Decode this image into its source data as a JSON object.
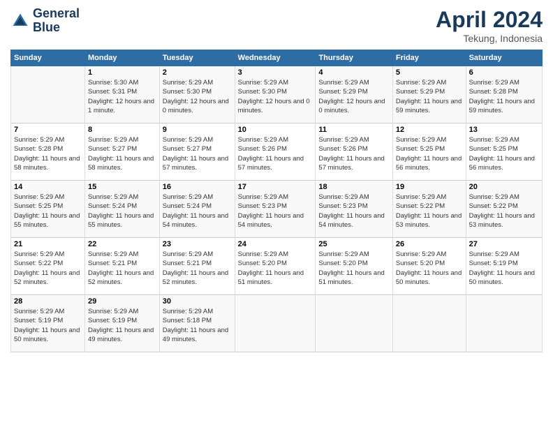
{
  "header": {
    "logo_line1": "General",
    "logo_line2": "Blue",
    "month": "April 2024",
    "location": "Tekung, Indonesia"
  },
  "columns": [
    "Sunday",
    "Monday",
    "Tuesday",
    "Wednesday",
    "Thursday",
    "Friday",
    "Saturday"
  ],
  "weeks": [
    [
      {
        "day": "",
        "sunrise": "",
        "sunset": "",
        "daylight": ""
      },
      {
        "day": "1",
        "sunrise": "Sunrise: 5:30 AM",
        "sunset": "Sunset: 5:31 PM",
        "daylight": "Daylight: 12 hours and 1 minute."
      },
      {
        "day": "2",
        "sunrise": "Sunrise: 5:29 AM",
        "sunset": "Sunset: 5:30 PM",
        "daylight": "Daylight: 12 hours and 0 minutes."
      },
      {
        "day": "3",
        "sunrise": "Sunrise: 5:29 AM",
        "sunset": "Sunset: 5:30 PM",
        "daylight": "Daylight: 12 hours and 0 minutes."
      },
      {
        "day": "4",
        "sunrise": "Sunrise: 5:29 AM",
        "sunset": "Sunset: 5:29 PM",
        "daylight": "Daylight: 12 hours and 0 minutes."
      },
      {
        "day": "5",
        "sunrise": "Sunrise: 5:29 AM",
        "sunset": "Sunset: 5:29 PM",
        "daylight": "Daylight: 11 hours and 59 minutes."
      },
      {
        "day": "6",
        "sunrise": "Sunrise: 5:29 AM",
        "sunset": "Sunset: 5:28 PM",
        "daylight": "Daylight: 11 hours and 59 minutes."
      }
    ],
    [
      {
        "day": "7",
        "sunrise": "Sunrise: 5:29 AM",
        "sunset": "Sunset: 5:28 PM",
        "daylight": "Daylight: 11 hours and 58 minutes."
      },
      {
        "day": "8",
        "sunrise": "Sunrise: 5:29 AM",
        "sunset": "Sunset: 5:27 PM",
        "daylight": "Daylight: 11 hours and 58 minutes."
      },
      {
        "day": "9",
        "sunrise": "Sunrise: 5:29 AM",
        "sunset": "Sunset: 5:27 PM",
        "daylight": "Daylight: 11 hours and 57 minutes."
      },
      {
        "day": "10",
        "sunrise": "Sunrise: 5:29 AM",
        "sunset": "Sunset: 5:26 PM",
        "daylight": "Daylight: 11 hours and 57 minutes."
      },
      {
        "day": "11",
        "sunrise": "Sunrise: 5:29 AM",
        "sunset": "Sunset: 5:26 PM",
        "daylight": "Daylight: 11 hours and 57 minutes."
      },
      {
        "day": "12",
        "sunrise": "Sunrise: 5:29 AM",
        "sunset": "Sunset: 5:25 PM",
        "daylight": "Daylight: 11 hours and 56 minutes."
      },
      {
        "day": "13",
        "sunrise": "Sunrise: 5:29 AM",
        "sunset": "Sunset: 5:25 PM",
        "daylight": "Daylight: 11 hours and 56 minutes."
      }
    ],
    [
      {
        "day": "14",
        "sunrise": "Sunrise: 5:29 AM",
        "sunset": "Sunset: 5:25 PM",
        "daylight": "Daylight: 11 hours and 55 minutes."
      },
      {
        "day": "15",
        "sunrise": "Sunrise: 5:29 AM",
        "sunset": "Sunset: 5:24 PM",
        "daylight": "Daylight: 11 hours and 55 minutes."
      },
      {
        "day": "16",
        "sunrise": "Sunrise: 5:29 AM",
        "sunset": "Sunset: 5:24 PM",
        "daylight": "Daylight: 11 hours and 54 minutes."
      },
      {
        "day": "17",
        "sunrise": "Sunrise: 5:29 AM",
        "sunset": "Sunset: 5:23 PM",
        "daylight": "Daylight: 11 hours and 54 minutes."
      },
      {
        "day": "18",
        "sunrise": "Sunrise: 5:29 AM",
        "sunset": "Sunset: 5:23 PM",
        "daylight": "Daylight: 11 hours and 54 minutes."
      },
      {
        "day": "19",
        "sunrise": "Sunrise: 5:29 AM",
        "sunset": "Sunset: 5:22 PM",
        "daylight": "Daylight: 11 hours and 53 minutes."
      },
      {
        "day": "20",
        "sunrise": "Sunrise: 5:29 AM",
        "sunset": "Sunset: 5:22 PM",
        "daylight": "Daylight: 11 hours and 53 minutes."
      }
    ],
    [
      {
        "day": "21",
        "sunrise": "Sunrise: 5:29 AM",
        "sunset": "Sunset: 5:22 PM",
        "daylight": "Daylight: 11 hours and 52 minutes."
      },
      {
        "day": "22",
        "sunrise": "Sunrise: 5:29 AM",
        "sunset": "Sunset: 5:21 PM",
        "daylight": "Daylight: 11 hours and 52 minutes."
      },
      {
        "day": "23",
        "sunrise": "Sunrise: 5:29 AM",
        "sunset": "Sunset: 5:21 PM",
        "daylight": "Daylight: 11 hours and 52 minutes."
      },
      {
        "day": "24",
        "sunrise": "Sunrise: 5:29 AM",
        "sunset": "Sunset: 5:20 PM",
        "daylight": "Daylight: 11 hours and 51 minutes."
      },
      {
        "day": "25",
        "sunrise": "Sunrise: 5:29 AM",
        "sunset": "Sunset: 5:20 PM",
        "daylight": "Daylight: 11 hours and 51 minutes."
      },
      {
        "day": "26",
        "sunrise": "Sunrise: 5:29 AM",
        "sunset": "Sunset: 5:20 PM",
        "daylight": "Daylight: 11 hours and 50 minutes."
      },
      {
        "day": "27",
        "sunrise": "Sunrise: 5:29 AM",
        "sunset": "Sunset: 5:19 PM",
        "daylight": "Daylight: 11 hours and 50 minutes."
      }
    ],
    [
      {
        "day": "28",
        "sunrise": "Sunrise: 5:29 AM",
        "sunset": "Sunset: 5:19 PM",
        "daylight": "Daylight: 11 hours and 50 minutes."
      },
      {
        "day": "29",
        "sunrise": "Sunrise: 5:29 AM",
        "sunset": "Sunset: 5:19 PM",
        "daylight": "Daylight: 11 hours and 49 minutes."
      },
      {
        "day": "30",
        "sunrise": "Sunrise: 5:29 AM",
        "sunset": "Sunset: 5:18 PM",
        "daylight": "Daylight: 11 hours and 49 minutes."
      },
      {
        "day": "",
        "sunrise": "",
        "sunset": "",
        "daylight": ""
      },
      {
        "day": "",
        "sunrise": "",
        "sunset": "",
        "daylight": ""
      },
      {
        "day": "",
        "sunrise": "",
        "sunset": "",
        "daylight": ""
      },
      {
        "day": "",
        "sunrise": "",
        "sunset": "",
        "daylight": ""
      }
    ]
  ]
}
